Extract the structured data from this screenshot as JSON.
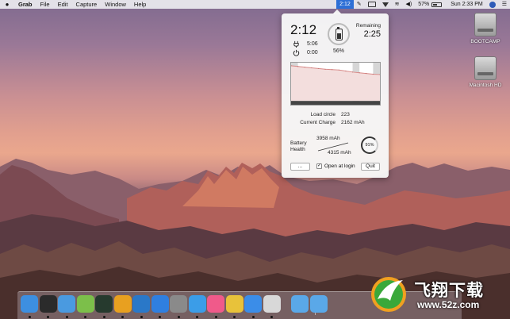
{
  "menubar": {
    "app_name": "Grab",
    "menus": [
      "File",
      "Edit",
      "Capture",
      "Window",
      "Help"
    ],
    "status_time": "2:12",
    "battery_percent": "57%",
    "clock": "Sun 2:33 PM"
  },
  "popover": {
    "elapsed_time": "2:12",
    "charge_time": "5:06",
    "standby_time": "0:00",
    "battery_percent": "56%",
    "remaining_label": "Remaining",
    "remaining_time": "2:25",
    "load_circle_label": "Load circle",
    "load_circle_value": "223",
    "current_charge_label": "Current Charge",
    "current_charge_value": "2162 mAh",
    "battery_health_label_1": "Battery",
    "battery_health_label_2": "Health",
    "design_capacity": "3958 mAh",
    "full_capacity": "4315 mAh",
    "health_percent": "91%",
    "more_button": "...",
    "open_at_login_label": "Open at login",
    "open_at_login_checked": true,
    "checkmark": "✓",
    "quit_button": "Quit",
    "history_chart": {
      "type": "area",
      "values": [
        100,
        98,
        96,
        94,
        92,
        90,
        89,
        88,
        85,
        82,
        80,
        78,
        76,
        75
      ],
      "ylim": [
        0,
        100
      ],
      "charging_bands": [
        [
          0,
          1
        ],
        [
          9,
          10
        ],
        [
          12,
          13
        ]
      ]
    }
  },
  "desktop_icons": [
    {
      "label": "BOOTCAMP"
    },
    {
      "label": "Macintosh HD"
    }
  ],
  "dock": {
    "apps": [
      {
        "name": "finder-icon",
        "color": "#3d8fe0"
      },
      {
        "name": "terminal-icon",
        "color": "#2b2b2b"
      },
      {
        "name": "xcode-icon",
        "color": "#4a9ae0"
      },
      {
        "name": "android-studio-icon",
        "color": "#7cbf4a"
      },
      {
        "name": "activity-monitor-icon",
        "color": "#263a2e"
      },
      {
        "name": "sublime-text-icon",
        "color": "#e8a020"
      },
      {
        "name": "visual-studio-code-icon",
        "color": "#2a78c8"
      },
      {
        "name": "maps-icon",
        "color": "#2f7fe0"
      },
      {
        "name": "system-preferences-icon",
        "color": "#8a8a8a"
      },
      {
        "name": "safari-icon",
        "color": "#3b9de8"
      },
      {
        "name": "itunes-icon",
        "color": "#f05a8a"
      },
      {
        "name": "chrome-icon",
        "color": "#e8c23a"
      },
      {
        "name": "app-store-icon",
        "color": "#3b8de8"
      },
      {
        "name": "preview-icon",
        "color": "#d8d8d8"
      },
      {
        "name": "applications-folder-icon",
        "color": "#5aa8e8"
      },
      {
        "name": "downloads-folder-icon",
        "color": "#5aa8e8"
      }
    ]
  },
  "watermark": {
    "title": "飞翔下载",
    "url": "www.52z.com"
  }
}
